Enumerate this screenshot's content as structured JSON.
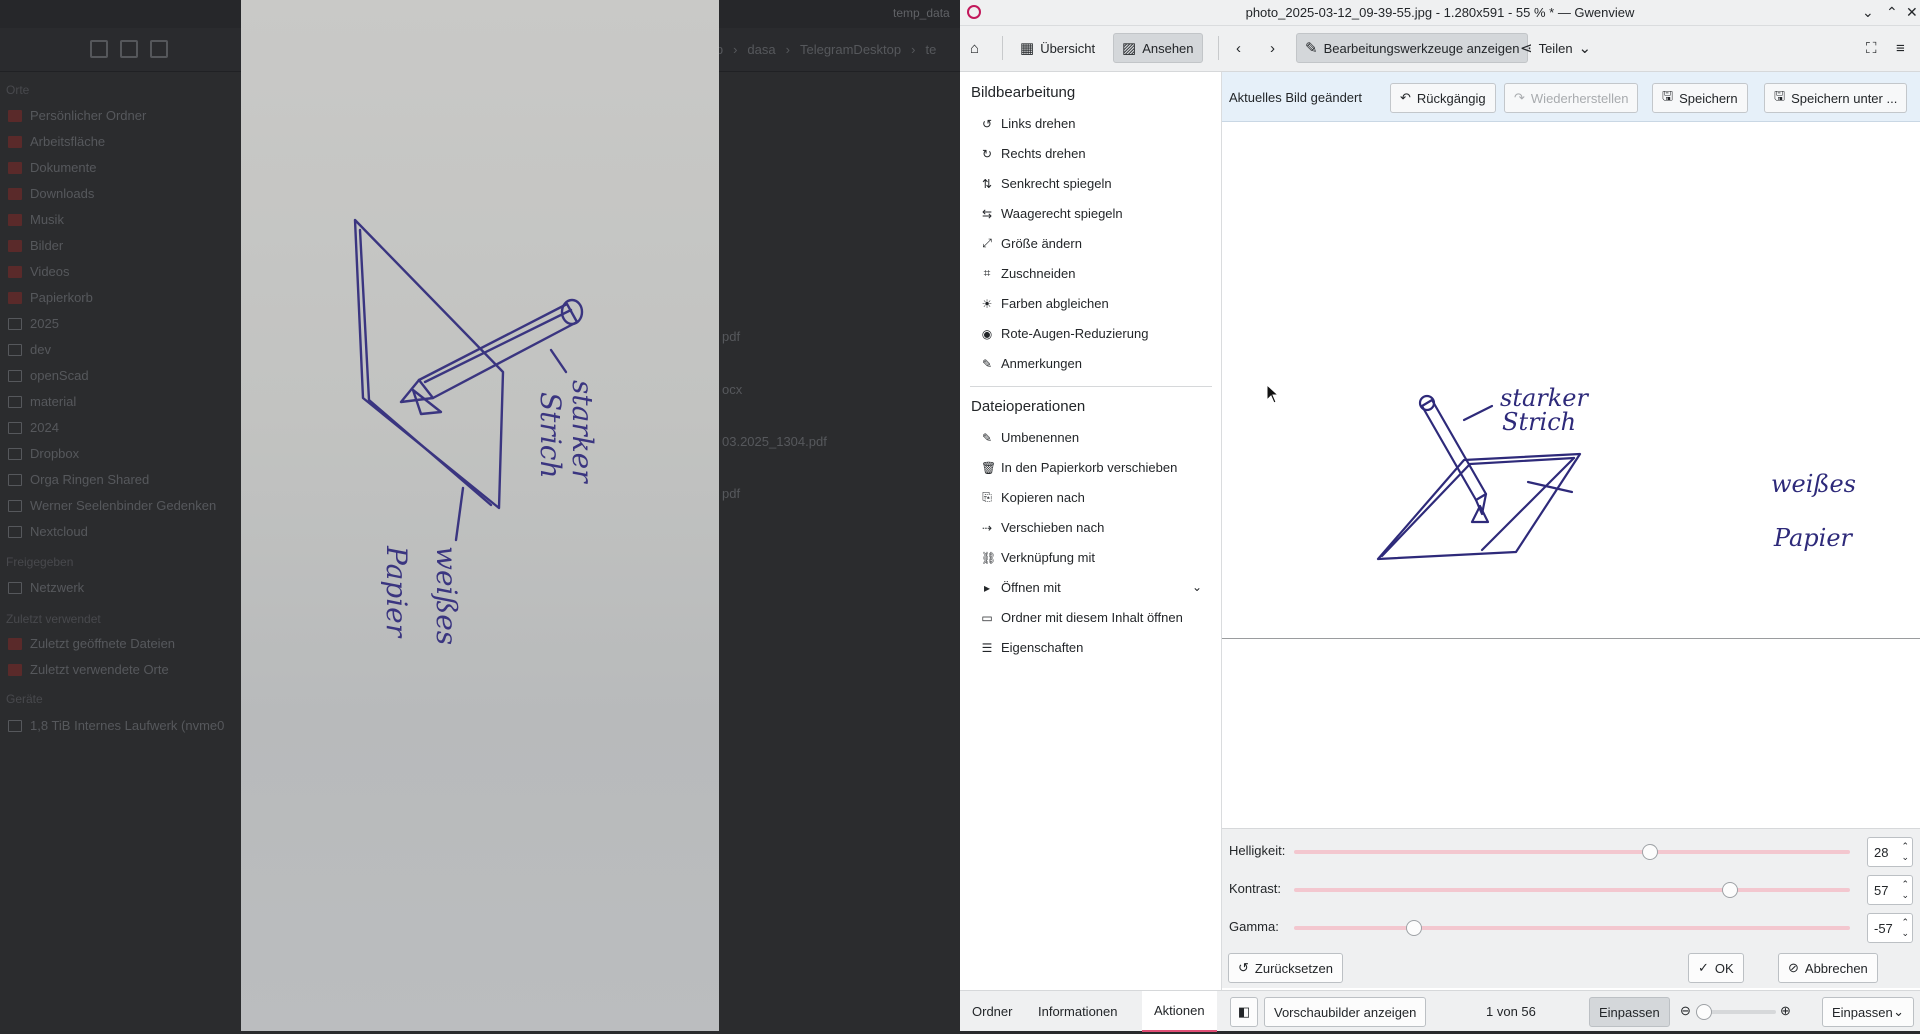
{
  "background_window": {
    "title": "temp_data",
    "path": [
      "top",
      "dasa",
      "TelegramDesktop",
      "te"
    ],
    "section_places": "Orte",
    "places": [
      "Persönlicher Ordner",
      "Arbeitsfläche",
      "Dokumente",
      "Downloads",
      "Musik",
      "Bilder",
      "Videos",
      "Papierkorb",
      "2025",
      "dev",
      "openScad",
      "material",
      "2024",
      "Dropbox",
      "Orga Ringen Shared",
      "Werner Seelenbinder Gedenken",
      "Nextcloud"
    ],
    "section_network": "Freigegeben",
    "network": [
      "Netzwerk"
    ],
    "section_recent": "Zuletzt verwendet",
    "recent": [
      "Zuletzt geöffnete Dateien",
      "Zuletzt verwendete Orte"
    ],
    "section_devices": "Geräte",
    "devices": [
      "1,8 TiB Internes Laufwerk (nvme0"
    ],
    "files": [
      "pdf",
      "ocx",
      "03.2025_1304.pdf",
      "pdf"
    ]
  },
  "window": {
    "title": "photo_2025-03-12_09-39-55.jpg - 1.280x591 - 55 % * — Gwenview"
  },
  "toolbar": {
    "overview": "Übersicht",
    "view": "Ansehen",
    "edit_tools": "Bearbeitungswerkzeuge anzeigen",
    "share": "Teilen"
  },
  "sidebar": {
    "image_edit_title": "Bildbearbeitung",
    "image_edit": [
      "Links drehen",
      "Rechts drehen",
      "Senkrecht spiegeln",
      "Waagerecht spiegeln",
      "Größe ändern",
      "Zuschneiden",
      "Farben abgleichen",
      "Rote-Augen-Reduzierung",
      "Anmerkungen"
    ],
    "file_ops_title": "Dateioperationen",
    "file_ops": [
      "Umbenennen",
      "In den Papierkorb verschieben",
      "Kopieren nach",
      "Verschieben nach",
      "Verknüpfung mit",
      "Öffnen mit",
      "Ordner mit diesem Inhalt öffnen",
      "Eigenschaften"
    ]
  },
  "editbar": {
    "status": "Aktuelles Bild geändert",
    "undo": "Rückgängig",
    "redo": "Wiederherstellen",
    "save": "Speichern",
    "save_as": "Speichern unter ..."
  },
  "photo_text": {
    "label1_line1": "starker",
    "label1_line2": "Strich",
    "label2_line1": "weißes",
    "label2_line2": "Papier"
  },
  "adjust": {
    "brightness_label": "Helligkeit:",
    "brightness": 28,
    "contrast_label": "Kontrast:",
    "contrast": 57,
    "gamma_label": "Gamma:",
    "gamma": -57,
    "slider_min": -100,
    "slider_max": 100,
    "reset": "Zurücksetzen",
    "ok": "OK",
    "cancel": "Abbrechen"
  },
  "bottom": {
    "tab_folders": "Ordner",
    "tab_info": "Informationen",
    "tab_actions": "Aktionen",
    "thumbnails": "Vorschaubilder anzeigen",
    "counter": "1 von 56",
    "fit": "Einpassen",
    "zoom_select": "Einpassen"
  },
  "colors": {
    "accent": "#e04e75",
    "ink": "#2e2a7a",
    "slider_track": "#f3c7cf"
  }
}
